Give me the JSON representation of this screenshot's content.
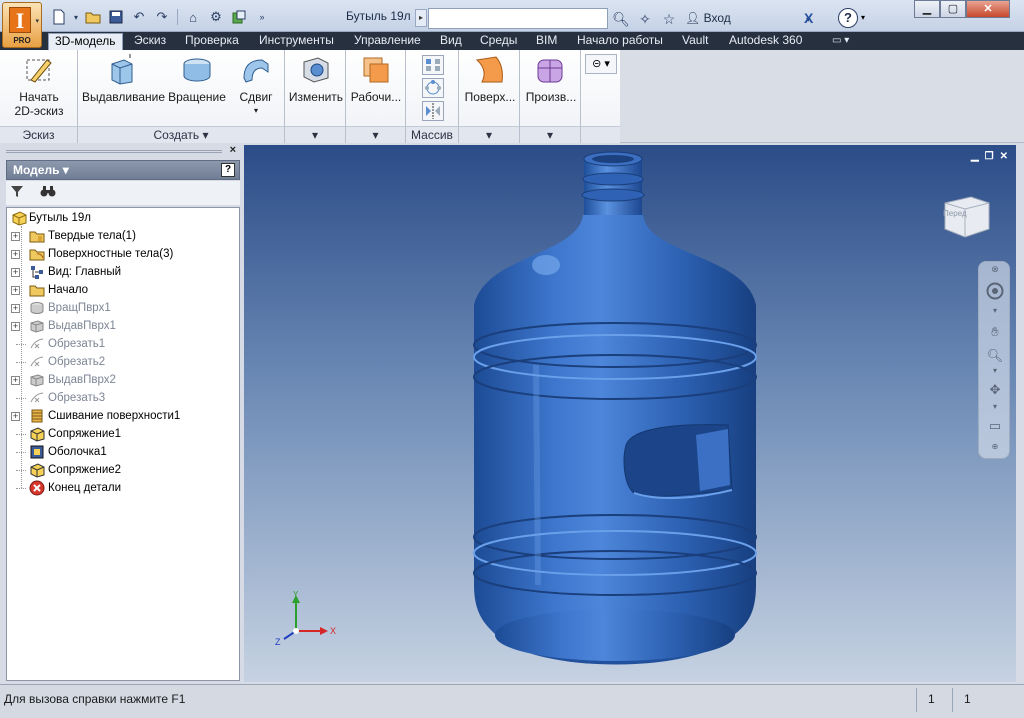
{
  "app": {
    "badge": "PRO",
    "document_title": "Бутыль 19л",
    "login_label": "Вход",
    "help_label": "?",
    "x_label": "X"
  },
  "window_controls": {
    "minimize": "▁",
    "maximize": "▢",
    "close": "✕"
  },
  "ribbon": {
    "tabs": [
      {
        "label": "3D-модель",
        "active": true
      },
      {
        "label": "Эскиз"
      },
      {
        "label": "Проверка"
      },
      {
        "label": "Инструменты"
      },
      {
        "label": "Управление"
      },
      {
        "label": "Вид"
      },
      {
        "label": "Среды"
      },
      {
        "label": "BIM"
      },
      {
        "label": "Начало работы"
      },
      {
        "label": "Vault"
      },
      {
        "label": "Autodesk 360"
      }
    ],
    "groups": {
      "sketch": {
        "label": "Эскиз",
        "start_sketch_line1": "Начать",
        "start_sketch_line2": "2D-эскиз"
      },
      "create": {
        "label": "Создать ▾",
        "extrude": "Выдавливание",
        "revolve": "Вращение",
        "sweep": "Сдвиг"
      },
      "modify": {
        "label": "▾",
        "button": "Изменить"
      },
      "work": {
        "label": "▾",
        "button": "Рабочи..."
      },
      "pattern": {
        "label": "Массив"
      },
      "surface": {
        "label": "▾",
        "button": "Поверх..."
      },
      "derive": {
        "label": "▾",
        "button": "Произв..."
      }
    }
  },
  "browser": {
    "title": "Модель ▾",
    "help": "?",
    "close": "×",
    "root": "Бутыль 19л",
    "items": [
      {
        "label": "Твердые тела(1)",
        "expand": true,
        "dim": false,
        "icon": "folder-solids-icon"
      },
      {
        "label": "Поверхностные тела(3)",
        "expand": true,
        "dim": false,
        "icon": "folder-surfaces-icon"
      },
      {
        "label": "Вид: Главный",
        "expand": true,
        "dim": false,
        "icon": "view-rep-icon"
      },
      {
        "label": "Начало",
        "expand": true,
        "dim": false,
        "icon": "origin-folder-icon"
      },
      {
        "label": "ВращПврх1",
        "expand": true,
        "dim": true,
        "icon": "revolve-surface-icon"
      },
      {
        "label": "ВыдавПврх1",
        "expand": true,
        "dim": true,
        "icon": "extrude-surface-icon"
      },
      {
        "label": "Обрезать1",
        "expand": false,
        "dim": true,
        "icon": "trim-icon"
      },
      {
        "label": "Обрезать2",
        "expand": false,
        "dim": true,
        "icon": "trim-icon"
      },
      {
        "label": "ВыдавПврх2",
        "expand": true,
        "dim": true,
        "icon": "extrude-surface-icon"
      },
      {
        "label": "Обрезать3",
        "expand": false,
        "dim": true,
        "icon": "trim-icon"
      },
      {
        "label": "Сшивание поверхности1",
        "expand": true,
        "dim": false,
        "icon": "stitch-icon"
      },
      {
        "label": "Сопряжение1",
        "expand": false,
        "dim": false,
        "icon": "fillet-icon"
      },
      {
        "label": "Оболочка1",
        "expand": false,
        "dim": false,
        "icon": "shell-icon"
      },
      {
        "label": "Сопряжение2",
        "expand": false,
        "dim": false,
        "icon": "fillet-icon"
      },
      {
        "label": "Конец детали",
        "expand": false,
        "dim": false,
        "icon": "end-of-part-icon"
      }
    ]
  },
  "viewport": {
    "viewcube_face": "Перед",
    "axis_x": "X",
    "axis_y": "Y",
    "axis_z": "Z",
    "colors": {
      "model": "#2e5fb0",
      "background_top": "#2b4c88",
      "background_bottom": "#c6d2e2"
    }
  },
  "statusbar": {
    "message": "Для вызова справки нажмите F1",
    "count1": "1",
    "count2": "1"
  }
}
